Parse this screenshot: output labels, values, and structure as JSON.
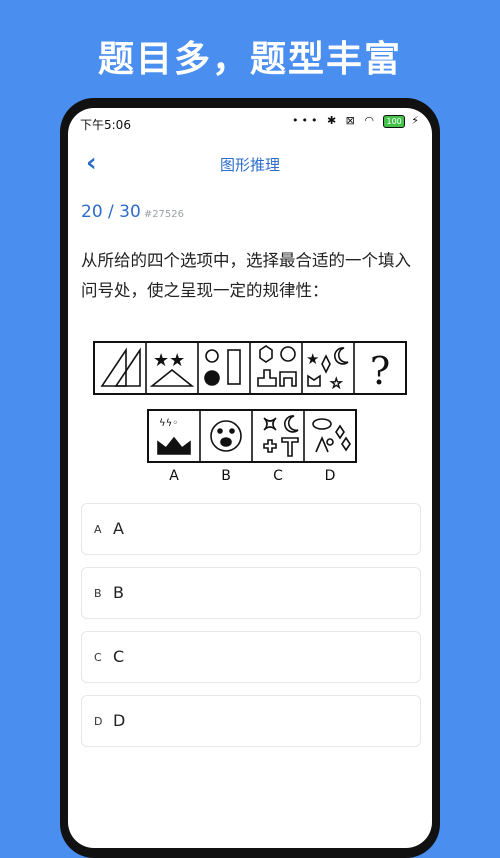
{
  "promo": {
    "headline": "题目多，题型丰富"
  },
  "status_bar": {
    "time": "下午5:06",
    "battery": "100"
  },
  "nav": {
    "title": "图形推理"
  },
  "progress": {
    "text": "20 / 30",
    "question_id": "#27526"
  },
  "question": {
    "text": "从所给的四个选项中，选择最合适的一个填入问号处，使之呈现一定的规律性："
  },
  "figure": {
    "unknown_mark": "?",
    "option_labels": [
      "A",
      "B",
      "C",
      "D"
    ]
  },
  "options": [
    {
      "key": "A",
      "value": "A"
    },
    {
      "key": "B",
      "value": "B"
    },
    {
      "key": "C",
      "value": "C"
    },
    {
      "key": "D",
      "value": "D"
    }
  ]
}
